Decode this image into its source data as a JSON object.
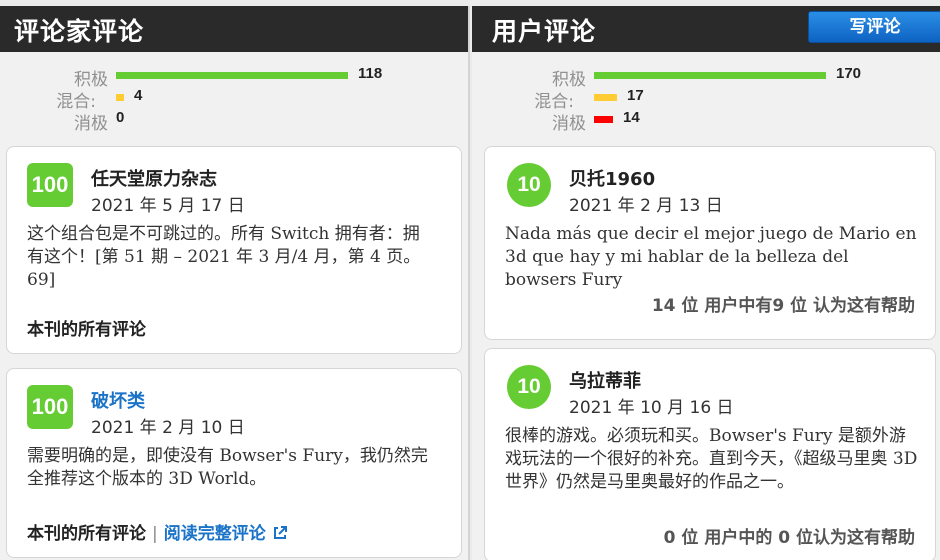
{
  "critic": {
    "title": "评论家评论",
    "distribution": [
      {
        "label": "积极",
        "count": "118",
        "color": "#66cc33",
        "fraction": 1.0
      },
      {
        "label": "混合:",
        "count": "4",
        "color": "#ffcc33",
        "fraction": 0.034
      },
      {
        "label": "消极",
        "count": "0",
        "color": "#ff0000",
        "fraction": 0.0
      }
    ],
    "reviews": [
      {
        "score": "100",
        "publication": "任天堂原力杂志",
        "date": "2021 年 5 月 17 日",
        "body": "这个组合包是不可跳过的。所有 Switch 拥有者：拥有这个！[第 51 期 – 2021 年 3 月/4 月，第 4 页。69]",
        "all_reviews_link": "本刊的所有评论"
      },
      {
        "score": "100",
        "publication": "破坏类",
        "date": "2021 年 2 月 10 日",
        "body": "需要明确的是，即使没有 Bowser's Fury，我仍然完全推荐这个版本的 3D World。",
        "all_reviews_link": "本刊的所有评论",
        "read_full_link": "阅读完整评论"
      }
    ]
  },
  "user": {
    "title": "用户评论",
    "write_button": "写评论",
    "distribution": [
      {
        "label": "积极",
        "count": "170",
        "color": "#66cc33",
        "fraction": 1.0
      },
      {
        "label": "混合:",
        "count": "17",
        "color": "#ffcc33",
        "fraction": 0.1
      },
      {
        "label": "消极",
        "count": "14",
        "color": "#ff0000",
        "fraction": 0.082
      }
    ],
    "reviews": [
      {
        "score": "10",
        "username": "贝托1960",
        "date": "2021 年 2 月 13 日",
        "body": "Nada más que decir el mejor juego de Mario en 3d que hay y mi hablar de la belleza del bowsers Fury",
        "helpful": "14 位 用户中有9 位 认为这有帮助"
      },
      {
        "score": "10",
        "username": "乌拉蒂菲",
        "date": "2021 年 10 月 16 日",
        "body": "很棒的游戏。必须玩和买。Bowser's Fury 是额外游戏玩法的一个很好的补充。直到今天，《超级马里奥 3D 世界》仍然是马里奥最好的作品之一。",
        "helpful": "0 位 用户中的 0 位认为这有帮助"
      }
    ]
  }
}
